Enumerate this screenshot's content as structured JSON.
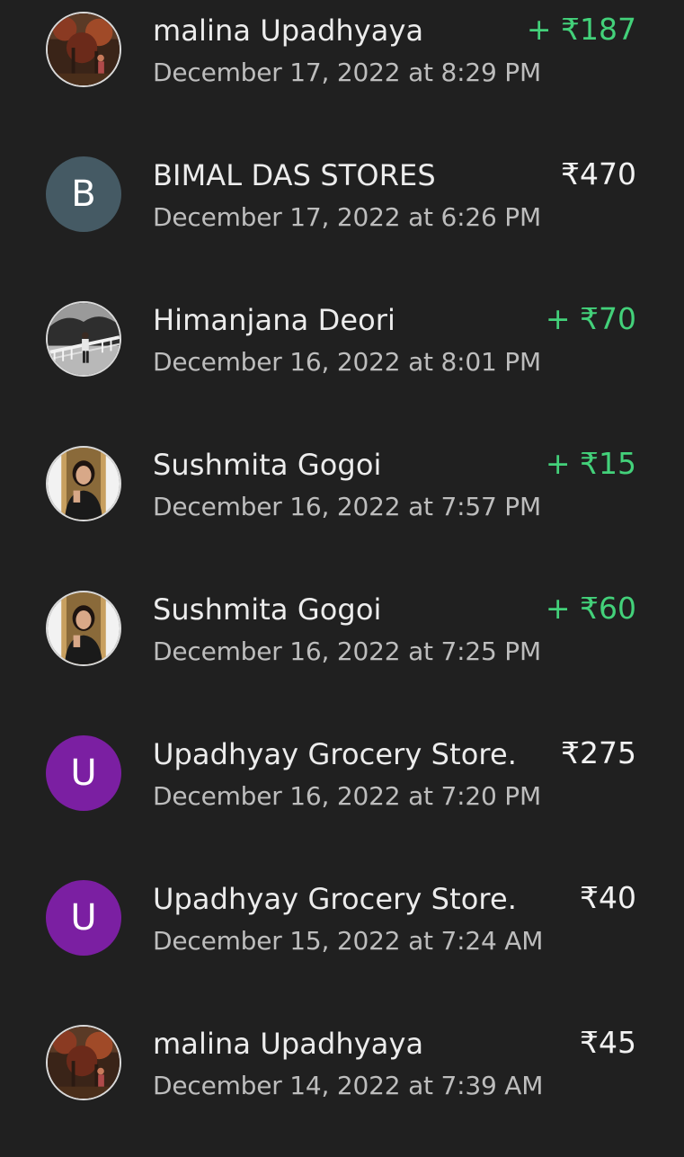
{
  "transactions": [
    {
      "name": "malina Upadhyaya",
      "date": "December 17, 2022 at 8:29 PM",
      "amount": "+ ₹187",
      "type": "credit",
      "avatar": {
        "kind": "photo",
        "icon": "autumn-trees-photo-icon"
      }
    },
    {
      "name": "BIMAL DAS STORES",
      "date": "December 17, 2022 at 6:26 PM",
      "amount": "₹470",
      "type": "debit",
      "avatar": {
        "kind": "letter",
        "letter": "B",
        "color": "#455a64"
      }
    },
    {
      "name": "Himanjana Deori",
      "date": "December 16, 2022 at 8:01 PM",
      "amount": "+ ₹70",
      "type": "credit",
      "avatar": {
        "kind": "photo",
        "icon": "bridge-person-photo-icon"
      }
    },
    {
      "name": "Sushmita Gogoi",
      "date": "December 16, 2022 at 7:57 PM",
      "amount": "+ ₹15",
      "type": "credit",
      "avatar": {
        "kind": "photo",
        "icon": "portrait-photo-icon"
      }
    },
    {
      "name": "Sushmita Gogoi",
      "date": "December 16, 2022 at 7:25 PM",
      "amount": "+ ₹60",
      "type": "credit",
      "avatar": {
        "kind": "photo",
        "icon": "portrait-photo-icon"
      }
    },
    {
      "name": "Upadhyay Grocery Store.",
      "date": "December 16, 2022 at 7:20 PM",
      "amount": "₹275",
      "type": "debit",
      "avatar": {
        "kind": "letter",
        "letter": "U",
        "color": "#7b1fa2"
      }
    },
    {
      "name": "Upadhyay Grocery Store.",
      "date": "December 15, 2022 at 7:24 AM",
      "amount": "₹40",
      "type": "debit",
      "avatar": {
        "kind": "letter",
        "letter": "U",
        "color": "#7b1fa2"
      }
    },
    {
      "name": "malina Upadhyaya",
      "date": "December 14, 2022 at 7:39 AM",
      "amount": "₹45",
      "type": "debit",
      "avatar": {
        "kind": "photo",
        "icon": "autumn-trees-photo-icon"
      }
    }
  ],
  "colors": {
    "background": "#202020",
    "credit": "#43d17a",
    "debit": "#f2f2f2",
    "date": "#bdbdbd"
  }
}
